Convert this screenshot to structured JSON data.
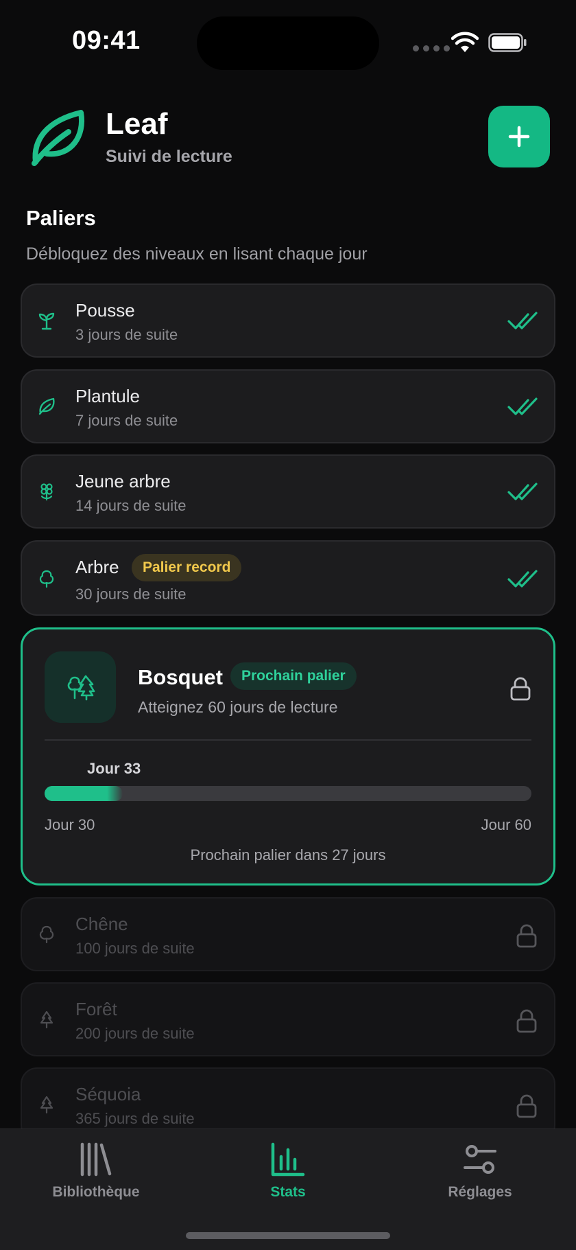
{
  "status": {
    "time": "09:41"
  },
  "header": {
    "title": "Leaf",
    "subtitle": "Suivi de lecture",
    "add_icon": "plus-icon"
  },
  "section": {
    "title": "Paliers",
    "subtitle": "Débloquez des niveaux en lisant chaque jour"
  },
  "tiers_done": [
    {
      "name": "Pousse",
      "days": "3 jours de suite",
      "icon": "sprout-icon"
    },
    {
      "name": "Plantule",
      "days": "7 jours de suite",
      "icon": "leaf-icon"
    },
    {
      "name": "Jeune arbre",
      "days": "14 jours de suite",
      "icon": "flower-icon"
    },
    {
      "name": "Arbre",
      "days": "30 jours de suite",
      "icon": "tree-icon",
      "badge": "Palier record"
    }
  ],
  "current": {
    "name": "Bosquet",
    "badge": "Prochain palier",
    "subtitle": "Atteignez 60 jours de lecture",
    "day_label": "Jour 33",
    "range_min": "Jour 30",
    "range_max": "Jour 60",
    "progress": 0.1,
    "remaining": "Prochain palier dans 27 jours"
  },
  "tiers_locked": [
    {
      "name": "Chêne",
      "days": "100 jours de suite",
      "icon": "tree-icon"
    },
    {
      "name": "Forêt",
      "days": "200 jours de suite",
      "icon": "pine-tree-icon"
    },
    {
      "name": "Séquoia",
      "days": "365 jours de suite",
      "icon": "pine-tree-icon"
    }
  ],
  "tabbar": {
    "items": [
      {
        "label": "Bibliothèque",
        "icon": "library-icon",
        "active": false
      },
      {
        "label": "Stats",
        "icon": "bar-chart-icon",
        "active": true
      },
      {
        "label": "Réglages",
        "icon": "sliders-icon",
        "active": false
      }
    ]
  },
  "colors": {
    "accent": "#1fbf8a",
    "record": "#f2c94c",
    "background": "#0b0b0c",
    "card": "#1c1c1e"
  }
}
